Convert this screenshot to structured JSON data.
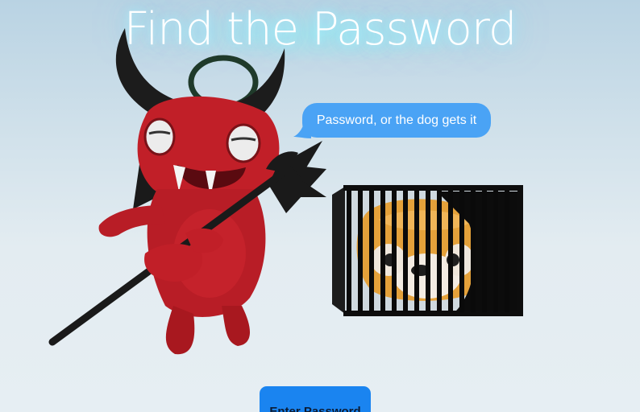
{
  "title": "Find the Password",
  "speech_bubble": "Password, or the dog gets it",
  "enter_button": "Enter Password",
  "colors": {
    "title_glow": "#9be8f5",
    "bubble": "#4aa3f5",
    "button": "#1a84f0",
    "devil_red": "#c8202a",
    "horn": "#1e1e1e",
    "dog": "#e8a23a"
  },
  "icons": {
    "devil": "devil-character-icon",
    "pitchfork": "pitchfork-icon",
    "halo": "halo-icon",
    "cage": "cage-icon",
    "dog": "dog-face-icon"
  }
}
